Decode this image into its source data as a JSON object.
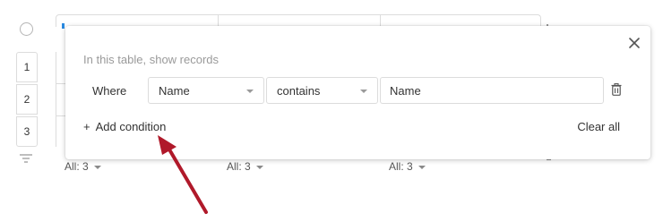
{
  "table": {
    "row_numbers": [
      "1",
      "2",
      "3"
    ],
    "footer_aggregates": [
      "All: 3",
      "All: 3",
      "All: 3"
    ]
  },
  "filter_popover": {
    "subtitle": "In this table, show records",
    "condition": {
      "where_label": "Where",
      "field": "Name",
      "operator": "contains",
      "value": "Name"
    },
    "add_condition_label": "Add condition",
    "add_condition_icon": "+",
    "clear_all_label": "Clear all"
  },
  "annotation": {
    "arrow_color": "#b0192a"
  },
  "colors": {
    "accent": "#2b8ae0",
    "border": "#dcdcdc",
    "muted_text": "#9a9a9a"
  }
}
